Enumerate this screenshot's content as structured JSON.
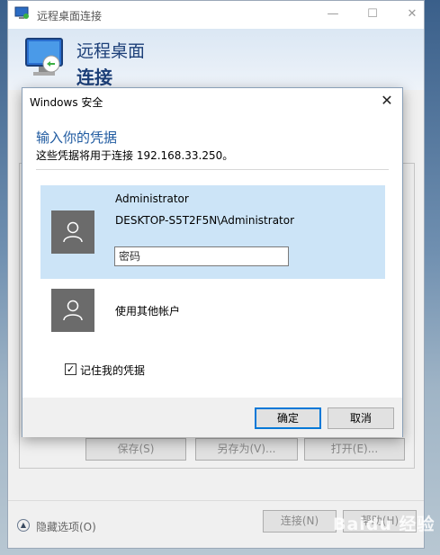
{
  "rdp_window": {
    "title": "远程桌面连接",
    "header_line1": "远程桌面",
    "header_line2": "连接",
    "buttons": {
      "save": "保存(S)",
      "save_as": "另存为(V)...",
      "open": "打开(E)..."
    },
    "hide_options": "隐藏选项(O)",
    "connect": "连接(N)",
    "help": "帮助(H)"
  },
  "security_dialog": {
    "title": "Windows 安全",
    "heading": "输入你的凭据",
    "subtitle": "这些凭据将用于连接 192.168.33.250。",
    "selected_account": {
      "name": "Administrator",
      "domain_user": "DESKTOP-S5T2F5N\\Administrator",
      "password_value": "",
      "password_placeholder": "密码"
    },
    "other_account_label": "使用其他帐户",
    "remember_label": "记住我的凭据",
    "remember_checked": true,
    "ok_button": "确定",
    "cancel_button": "取消"
  },
  "watermark": "Baidu 经验",
  "icons": [
    "rdp-app-icon",
    "rdp-logo-icon",
    "minimize-icon",
    "maximize-icon",
    "close-icon",
    "user-avatar-icon",
    "chevron-up-icon",
    "checkbox-check-icon"
  ],
  "colors": {
    "heading_blue": "#1f5aa0",
    "selected_bg": "#cce4f7",
    "primary_border": "#0078d7",
    "avatar_gray": "#6b6b6b"
  }
}
